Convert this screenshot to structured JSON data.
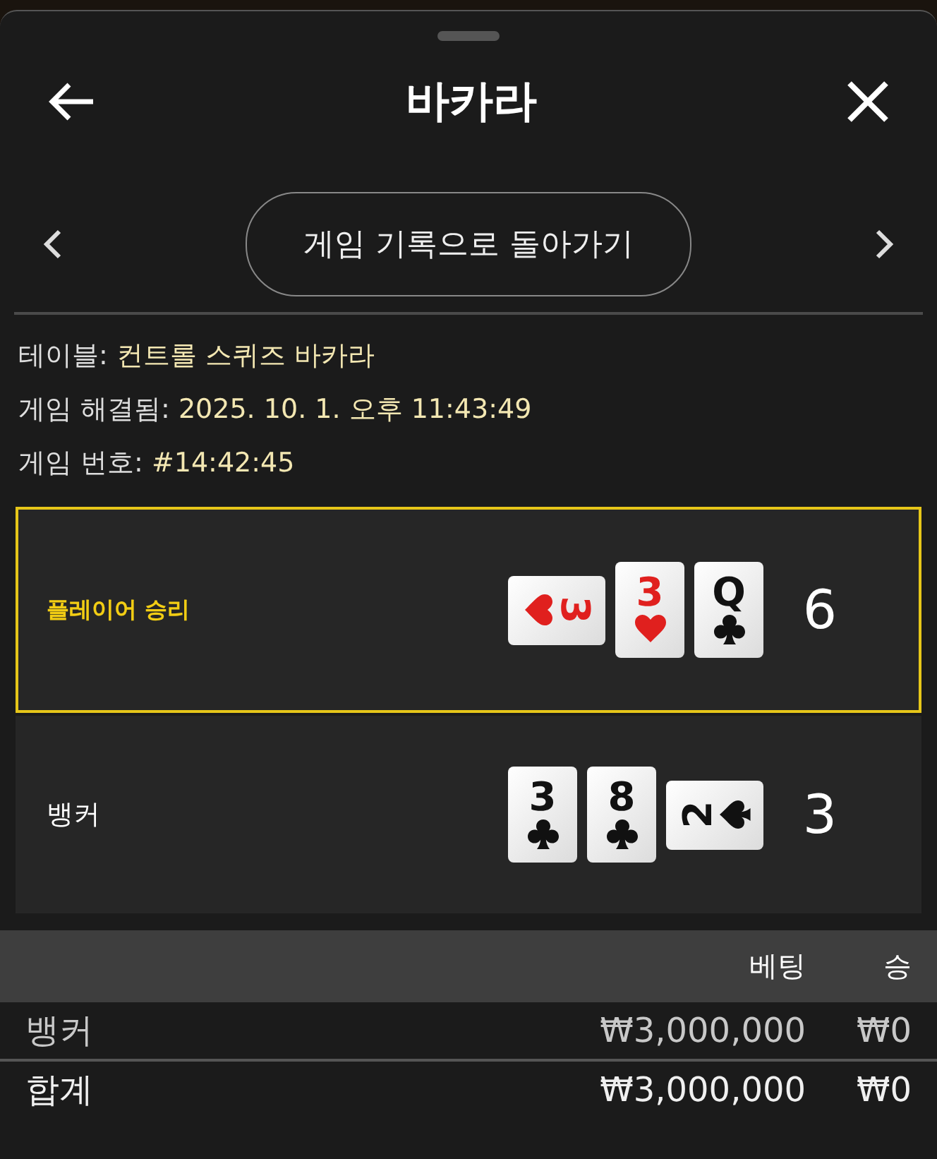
{
  "header": {
    "title": "바카라"
  },
  "history_button": {
    "label": "게임 기록으로 돌아가기"
  },
  "info": [
    {
      "label": "테이블:",
      "value": "컨트롤 스퀴즈 바카라"
    },
    {
      "label": "게임 해결됨:",
      "value": "2025. 10. 1. 오후 11:43:49"
    },
    {
      "label": "게임 번호:",
      "value": "#14:42:45"
    }
  ],
  "hands": [
    {
      "name": "플레이어 승리",
      "winner": true,
      "total": "6",
      "cards": [
        {
          "rank": "3",
          "kind": "hearts",
          "sideways": true,
          "reversed": false
        },
        {
          "rank": "3",
          "kind": "hearts",
          "sideways": false,
          "reversed": false
        },
        {
          "rank": "Q",
          "kind": "clubs",
          "sideways": false,
          "reversed": false
        }
      ]
    },
    {
      "name": "뱅커",
      "winner": false,
      "total": "3",
      "cards": [
        {
          "rank": "3",
          "kind": "clubs",
          "sideways": false,
          "reversed": false
        },
        {
          "rank": "8",
          "kind": "clubs",
          "sideways": false,
          "reversed": false
        },
        {
          "rank": "2",
          "kind": "spades",
          "sideways": true,
          "reversed": true
        }
      ]
    }
  ],
  "bets": {
    "columns": [
      "베팅",
      "승"
    ],
    "rows": [
      {
        "kind": "bet",
        "label": "뱅커",
        "bet": "₩3,000,000",
        "win": "₩0"
      },
      {
        "kind": "total",
        "label": "합계",
        "bet": "₩3,000,000",
        "win": "₩0"
      }
    ]
  }
}
